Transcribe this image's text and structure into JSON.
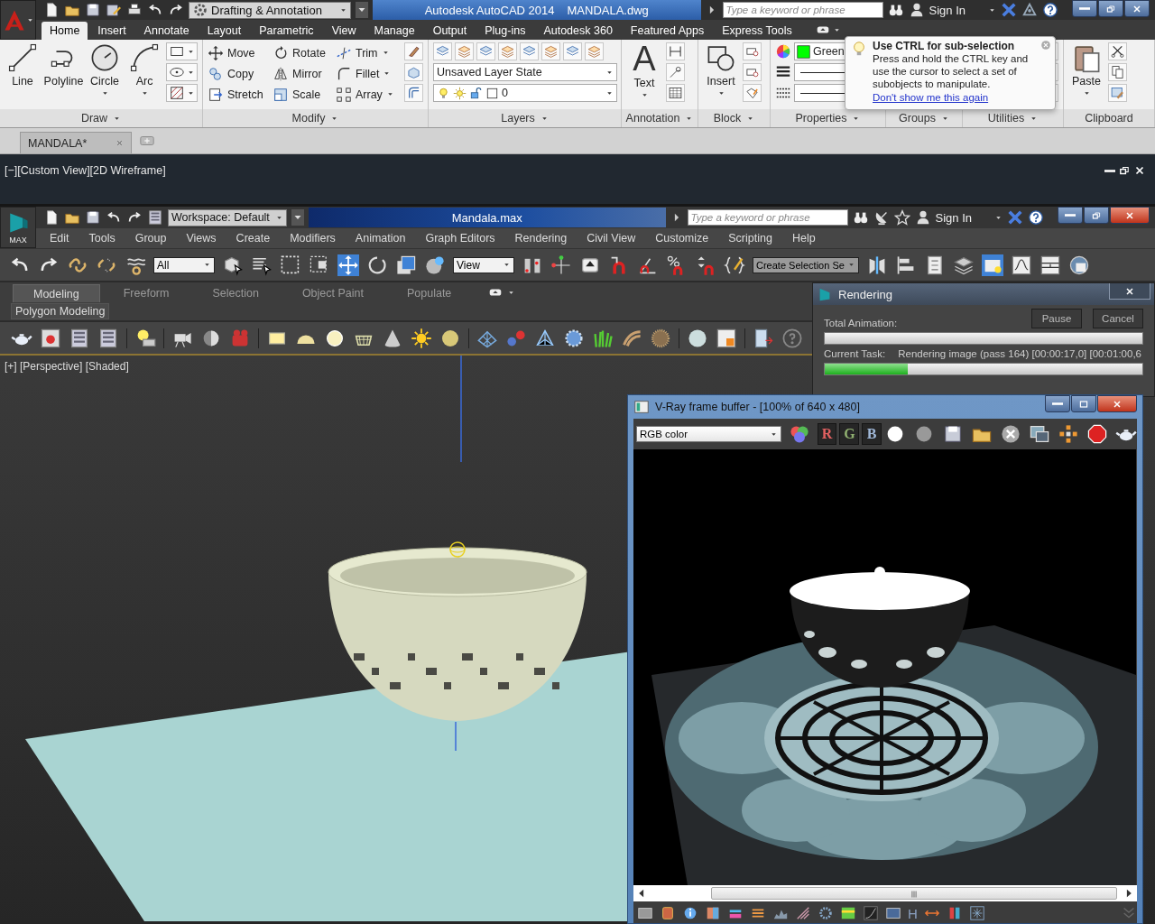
{
  "autocad": {
    "workspace": "Drafting & Annotation",
    "app_title": "Autodesk AutoCAD 2014",
    "file_name": "MANDALA.dwg",
    "search": {
      "placeholder": "Type a keyword or phrase"
    },
    "sign_in": "Sign In",
    "ribbon_tabs": [
      {
        "label": "Home",
        "selected": true
      },
      {
        "label": "Insert",
        "selected": false
      },
      {
        "label": "Annotate",
        "selected": false
      },
      {
        "label": "Layout",
        "selected": false
      },
      {
        "label": "Parametric",
        "selected": false
      },
      {
        "label": "View",
        "selected": false
      },
      {
        "label": "Manage",
        "selected": false
      },
      {
        "label": "Output",
        "selected": false
      },
      {
        "label": "Plug-ins",
        "selected": false
      },
      {
        "label": "Autodesk 360",
        "selected": false
      },
      {
        "label": "Featured Apps",
        "selected": false
      },
      {
        "label": "Express Tools",
        "selected": false
      }
    ],
    "draw": {
      "title": "Draw",
      "tools": [
        {
          "label": "Line",
          "has_menu": false
        },
        {
          "label": "Polyline",
          "has_menu": false
        },
        {
          "label": "Circle",
          "has_menu": true
        },
        {
          "label": "Arc",
          "has_menu": true
        }
      ]
    },
    "modify": {
      "title": "Modify",
      "tools": [
        {
          "label": "Move",
          "has_menu": false
        },
        {
          "label": "Rotate",
          "has_menu": false
        },
        {
          "label": "Trim",
          "has_menu": true
        },
        {
          "label": "Copy",
          "has_menu": false
        },
        {
          "label": "Mirror",
          "has_menu": false
        },
        {
          "label": "Fillet",
          "has_menu": true
        },
        {
          "label": "Stretch",
          "has_menu": false
        },
        {
          "label": "Scale",
          "has_menu": false
        },
        {
          "label": "Array",
          "has_menu": true
        }
      ]
    },
    "layers": {
      "title": "Layers",
      "layer_state": "Unsaved Layer State",
      "current_layer": "0"
    },
    "annotation": {
      "title": "Annotation",
      "icon_glyph": "A",
      "tool": "Text"
    },
    "block": {
      "title": "Block",
      "tool": "Insert"
    },
    "properties": {
      "title": "Properties",
      "color_name": "Green"
    },
    "groups": {
      "title": "Groups"
    },
    "utilities": {
      "title": "Utilities"
    },
    "clipboard": {
      "title": "Clipboard",
      "tool": "Paste"
    },
    "tooltip": {
      "title": "Use CTRL for sub-selection",
      "body": "Press and hold the CTRL key and use the cursor to select a set of subobjects to manipulate.",
      "link": "Don't show me this again"
    },
    "document_tabs": [
      {
        "label": "MANDALA*",
        "selected": true
      }
    ],
    "viewport_label": "[−][Custom View][2D Wireframe]"
  },
  "max": {
    "logo_text": "MAX",
    "workspace": "Workspace: Default",
    "file_name": "Mandala.max",
    "search": {
      "placeholder": "Type a keyword or phrase"
    },
    "sign_in": "Sign In",
    "menu": [
      "Edit",
      "Tools",
      "Group",
      "Views",
      "Create",
      "Modifiers",
      "Animation",
      "Graph Editors",
      "Rendering",
      "Civil View",
      "Customize",
      "Scripting",
      "Help"
    ],
    "selection_filter": "All",
    "reference_coordinates": "View",
    "selection_set": "Create Selection Se",
    "ribbon_tabs": [
      {
        "label": "Modeling",
        "selected": true
      },
      {
        "label": "Freeform",
        "selected": false
      },
      {
        "label": "Selection",
        "selected": false
      },
      {
        "label": "Object Paint",
        "selected": false
      },
      {
        "label": "Populate",
        "selected": false
      }
    ],
    "ribbon_panel": "Polygon Modeling",
    "viewport_label": "[+] [Perspective] [Shaded]",
    "rendering": {
      "title": "Rendering",
      "total_label": "Total Animation:",
      "total_progress": {
        "level": 0
      },
      "pause": "Pause",
      "cancel": "Cancel",
      "task_label": "Current Task:",
      "task": "Rendering image (pass 164) [00:00:17,0] [00:01:00,6",
      "task_progress": {
        "level": 0.26
      }
    },
    "frame_buffer": {
      "title": "V-Ray frame buffer - [100% of 640 x 480]",
      "channel": "RGB color",
      "channels": [
        {
          "label": "R",
          "color": "#e06060"
        },
        {
          "label": "G",
          "color": "#90b070"
        },
        {
          "label": "B",
          "color": "#a0b8d8"
        }
      ],
      "bottom_glyph": "H"
    }
  }
}
